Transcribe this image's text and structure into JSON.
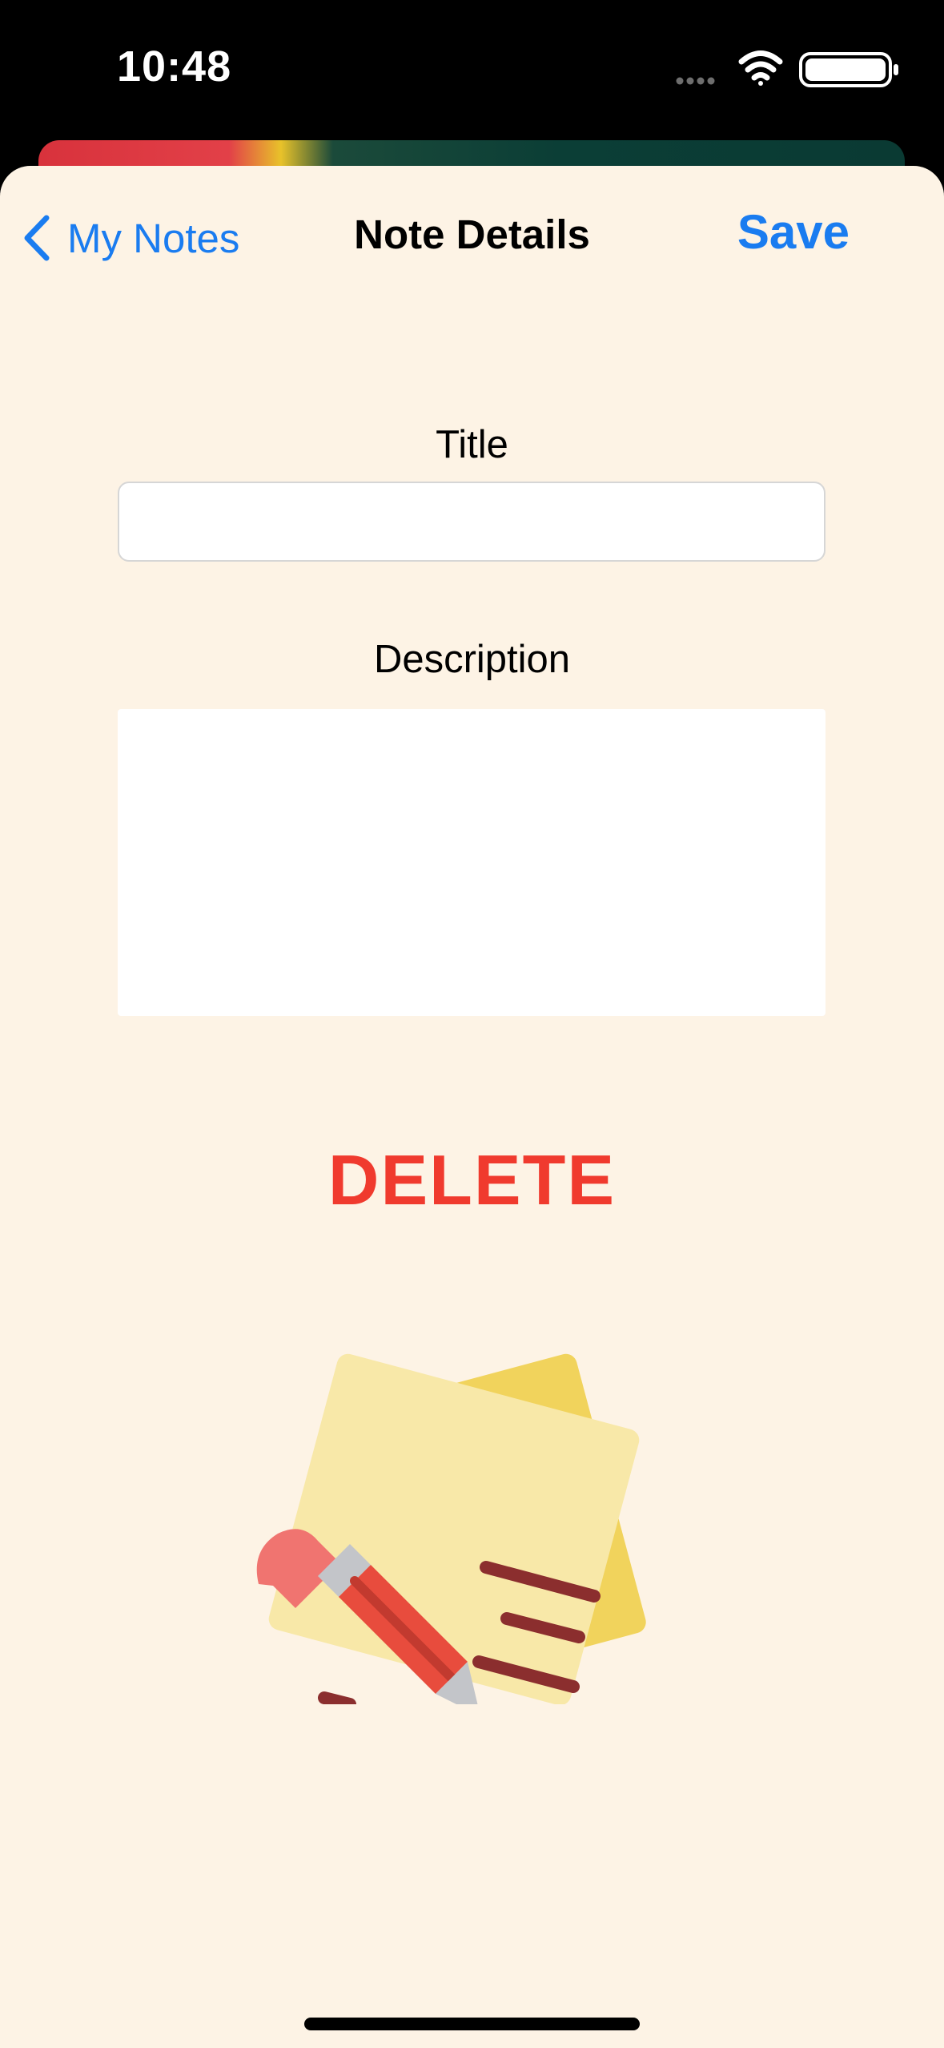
{
  "status_bar": {
    "time": "10:48",
    "icons": [
      "signal-dots-icon",
      "wifi-icon",
      "battery-icon"
    ]
  },
  "nav": {
    "back_label": "My Notes",
    "title": "Note Details",
    "save_label": "Save"
  },
  "form": {
    "title_label": "Title",
    "title_value": "",
    "description_label": "Description",
    "description_value": ""
  },
  "actions": {
    "delete_label": "DELETE"
  },
  "illustration": {
    "icon": "sticky-note-pencil-icon"
  },
  "colors": {
    "accent": "#1a7cf0",
    "destructive": "#f03a2e",
    "sheet_background": "#fdf3e5"
  }
}
